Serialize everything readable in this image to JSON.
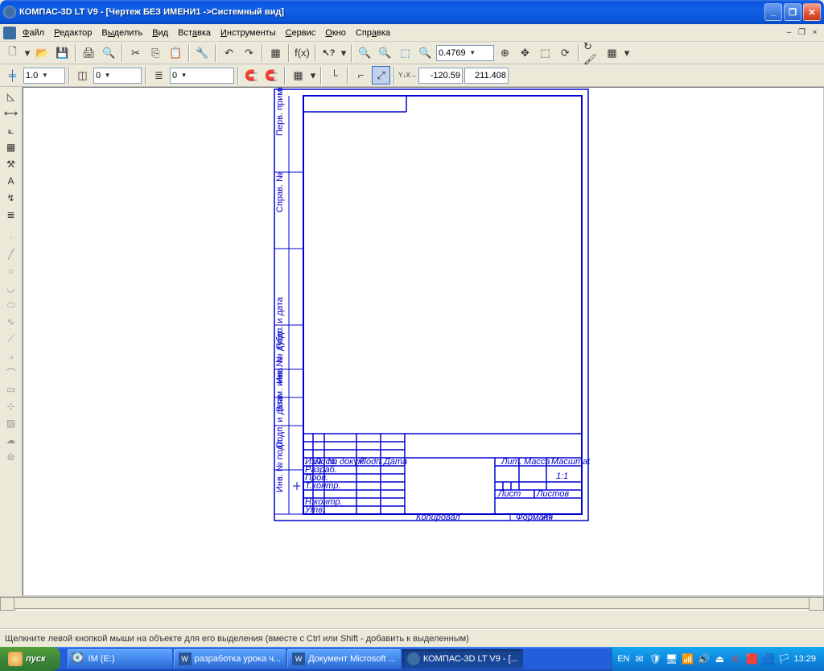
{
  "titlebar": {
    "title": "КОМПАС-3D LT V9 - [Чертеж БЕЗ ИМЕНИ1 ->Системный вид]"
  },
  "menus": {
    "file": "Файл",
    "edit": "Редактор",
    "select": "Выделить",
    "view": "Вид",
    "insert": "Вставка",
    "tools": "Инструменты",
    "service": "Сервис",
    "window": "Окно",
    "help": "Справка"
  },
  "toolbar2": {
    "scale": "1.0",
    "layer_state": "0",
    "layer": "0",
    "zoom": "0.4769",
    "coord_x": "-120.59",
    "coord_y": "211.408"
  },
  "titleblock": {
    "col_izm": "Изм.",
    "col_list": "Лист",
    "col_doc": "№ докум.",
    "col_sign": "Подп.",
    "col_date": "Дата",
    "row_razrab": "Разраб.",
    "row_prov": "Пров.",
    "row_tkontr": "Т.контр.",
    "row_nkontr": "Н.контр.",
    "row_utv": "Утв.",
    "lit": "Лит.",
    "massa": "Масса",
    "masshtab": "Масштаб",
    "masshtab_val": "1:1",
    "list": "Лист",
    "listov": "Листов",
    "kopiroval": "Копировал",
    "format": "Формат",
    "format_val": "A4",
    "side_perv": "Перв. примен.",
    "side_sprav": "Справ. №",
    "side_podp_data": "Подп. и дата",
    "side_inv_dubl": "Инв. № дубл.",
    "side_vzam": "Взам. инв. №",
    "side_podp_data2": "Подп. и дата",
    "side_inv_podl": "Инв. № подл."
  },
  "statusbar": {
    "hint": "Щелкните левой кнопкой мыши на объекте для его выделения (вместе с Ctrl или Shift - добавить к выделенным)"
  },
  "taskbar": {
    "start": "пуск",
    "items": [
      {
        "label": "IM (E:)"
      },
      {
        "label": "разработка урока ч..."
      },
      {
        "label": "Документ Microsoft ..."
      },
      {
        "label": "КОМПАС-3D LT V9 - [..."
      }
    ],
    "lang": "EN",
    "clock": "13:29"
  }
}
